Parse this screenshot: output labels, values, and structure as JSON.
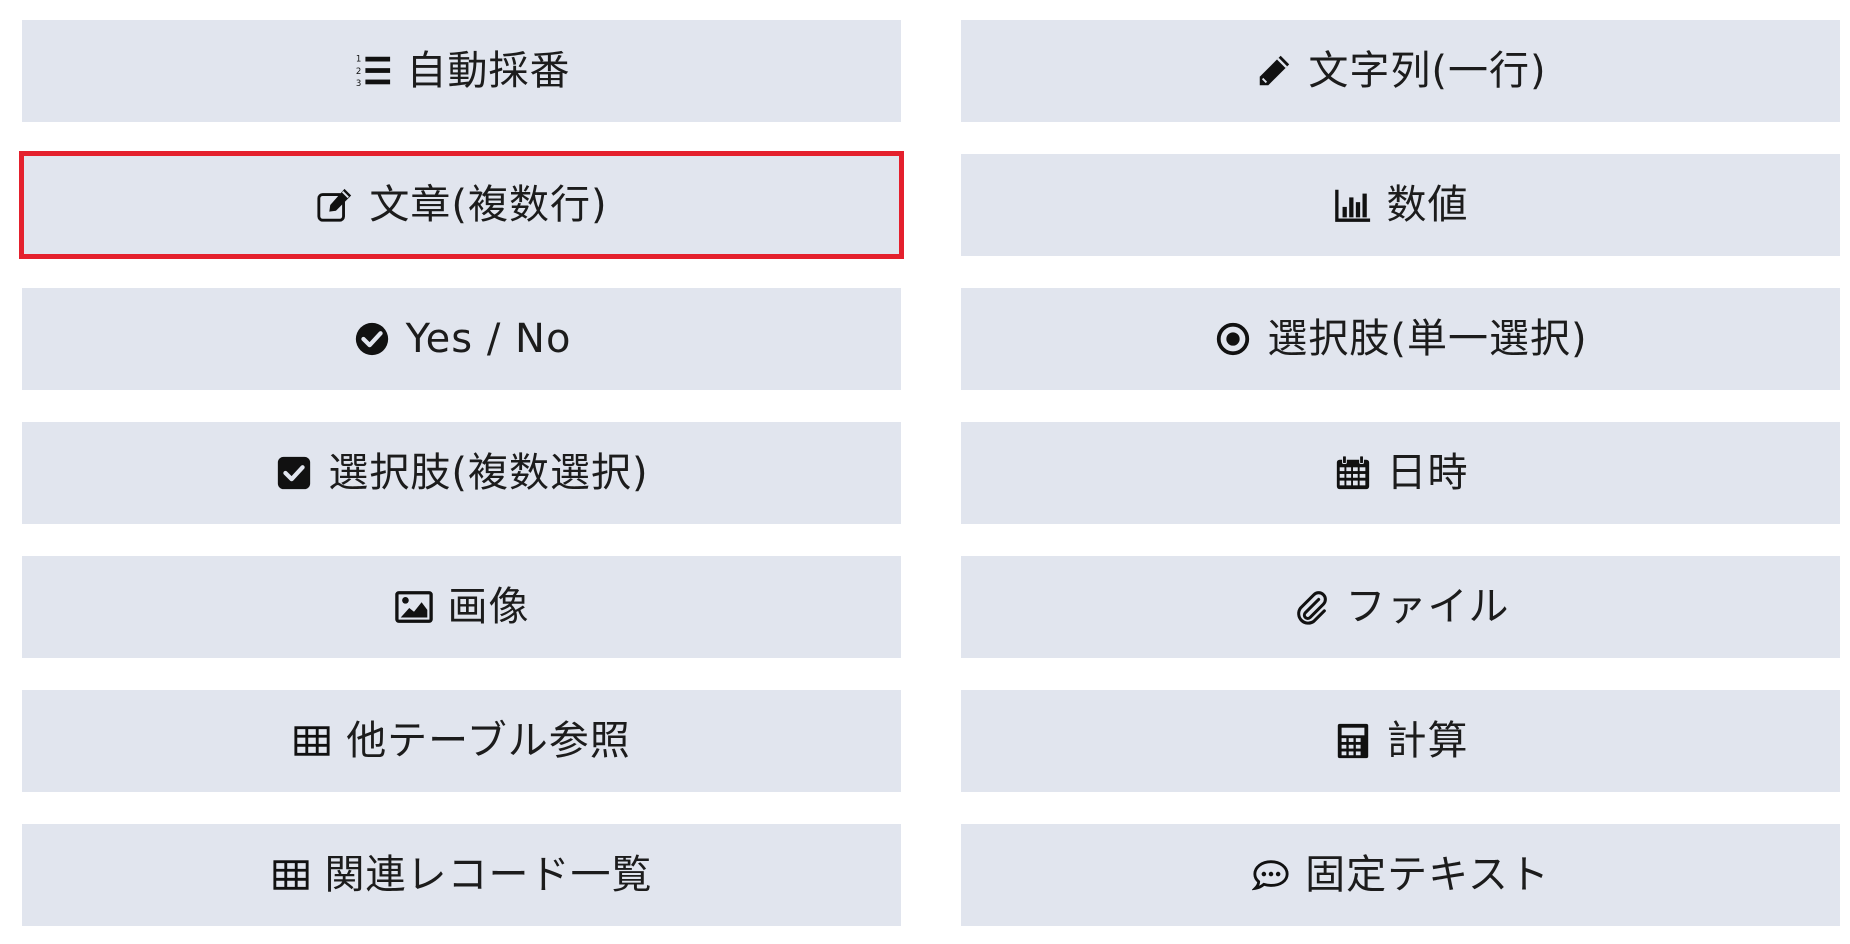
{
  "field_types": [
    {
      "id": "auto-number",
      "label": "自動採番",
      "icon": "ordered-list-icon"
    },
    {
      "id": "single-line-text",
      "label": "文字列(一行)",
      "icon": "pencil-icon"
    },
    {
      "id": "multi-line-text",
      "label": "文章(複数行)",
      "icon": "edit-square-icon",
      "selected": true
    },
    {
      "id": "number",
      "label": "数値",
      "icon": "bar-chart-icon"
    },
    {
      "id": "yes-no",
      "label": "Yes / No",
      "icon": "check-circle-icon"
    },
    {
      "id": "single-choice",
      "label": "選択肢(単一選択)",
      "icon": "radio-dot-icon"
    },
    {
      "id": "multi-choice",
      "label": "選択肢(複数選択)",
      "icon": "check-square-icon"
    },
    {
      "id": "datetime",
      "label": "日時",
      "icon": "calendar-icon"
    },
    {
      "id": "image",
      "label": "画像",
      "icon": "image-icon"
    },
    {
      "id": "file",
      "label": "ファイル",
      "icon": "paperclip-icon"
    },
    {
      "id": "table-reference",
      "label": "他テーブル参照",
      "icon": "table-icon"
    },
    {
      "id": "calculation",
      "label": "計算",
      "icon": "calculator-icon"
    },
    {
      "id": "related-records",
      "label": "関連レコード一覧",
      "icon": "table-icon"
    },
    {
      "id": "fixed-text",
      "label": "固定テキスト",
      "icon": "comment-dots-icon"
    }
  ],
  "colors": {
    "button_bg": "#e1e5ee",
    "selected_outline": "#e4202d",
    "text": "#1c1c1c"
  }
}
